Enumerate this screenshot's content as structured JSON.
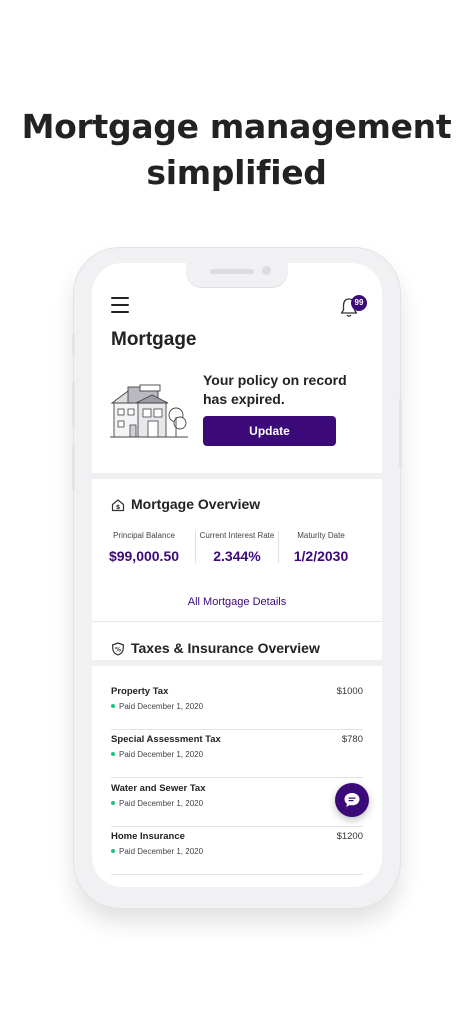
{
  "headline": {
    "line1": "Mortgage management",
    "line2": "simplified"
  },
  "app": {
    "header": {
      "menu_icon": "hamburger-menu-icon",
      "bell_icon": "bell-icon",
      "notification_count": "99"
    },
    "title": "Mortgage",
    "policy_banner": {
      "message": "Your policy on record has expired.",
      "button_label": "Update",
      "illustration": "house-illustration"
    },
    "mortgage_overview": {
      "title": "Mortgage Overview",
      "icon": "house-dollar-icon",
      "stats": [
        {
          "label": "Principal Balance",
          "value": "$99,000.50"
        },
        {
          "label": "Current Interest Rate",
          "value": "2.344%"
        },
        {
          "label": "Maturity Date",
          "value": "1/2/2030"
        }
      ],
      "details_link": "All Mortgage Details"
    },
    "taxes_overview": {
      "title": "Taxes & Insurance Overview",
      "icon": "shield-percent-icon",
      "rows": [
        {
          "name": "Property Tax",
          "amount": "$1000",
          "status": "Paid December 1, 2020"
        },
        {
          "name": "Special Assessment Tax",
          "amount": "$780",
          "status": "Paid December 1, 2020"
        },
        {
          "name": "Water and Sewer Tax",
          "amount": "",
          "status": "Paid December 1, 2020"
        },
        {
          "name": "Home Insurance",
          "amount": "$1200",
          "status": "Paid December 1, 2020"
        }
      ]
    },
    "chat_icon": "chat-bubble-icon",
    "colors": {
      "accent": "#3b0a78",
      "paid_dot": "#1bc47d"
    }
  }
}
